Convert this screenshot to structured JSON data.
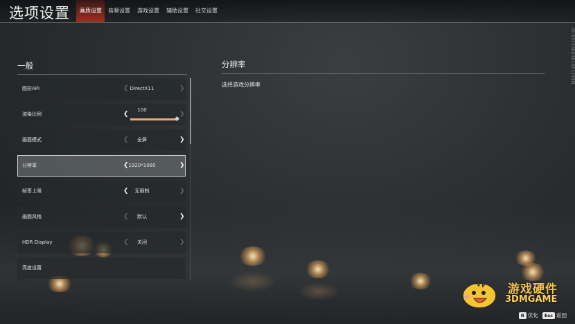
{
  "header": {
    "title": "选项设置",
    "tabs": [
      {
        "label": "画质设置",
        "active": true
      },
      {
        "label": "音频设置",
        "active": false
      },
      {
        "label": "游戏设置",
        "active": false
      },
      {
        "label": "辅助设置",
        "active": false
      },
      {
        "label": "社交设置",
        "active": false
      }
    ]
  },
  "side_code": "ID:93253003016E12Y9N",
  "left_section": {
    "title": "一般",
    "rows": [
      {
        "label": "图形API",
        "value": "DirectX11",
        "left_enabled": false,
        "right_enabled": false
      },
      {
        "label": "渲染比例",
        "value": "100",
        "left_enabled": true,
        "right_enabled": false,
        "slider_level": 1.0
      },
      {
        "label": "画面模式",
        "value": "全屏",
        "left_enabled": false,
        "right_enabled": true
      },
      {
        "label": "分辨率",
        "value": "1920*1080",
        "left_enabled": true,
        "right_enabled": true,
        "selected": true
      },
      {
        "label": "帧率上限",
        "value": "无限制",
        "left_enabled": true,
        "right_enabled": false
      },
      {
        "label": "画面风格",
        "value": "默认",
        "left_enabled": false,
        "right_enabled": true
      },
      {
        "label": "HDR Display",
        "value": "关闭",
        "left_enabled": false,
        "right_enabled": false
      },
      {
        "label": "亮度设置",
        "value": "",
        "left_enabled": false,
        "right_enabled": false
      }
    ]
  },
  "right_section": {
    "title": "分辨率",
    "description": "选择游戏分辨率"
  },
  "watermark": {
    "line1": "游戏硬件",
    "line2": "3DMGAME"
  },
  "hints": [
    {
      "key": "R",
      "label": "优化"
    },
    {
      "key": "Esc",
      "label": "返回"
    }
  ],
  "colors": {
    "accent": "#c8321e",
    "slider_fill": "#e8a877"
  },
  "icons": {
    "arrow_left": "chevron-left-icon",
    "arrow_right": "chevron-right-icon"
  }
}
